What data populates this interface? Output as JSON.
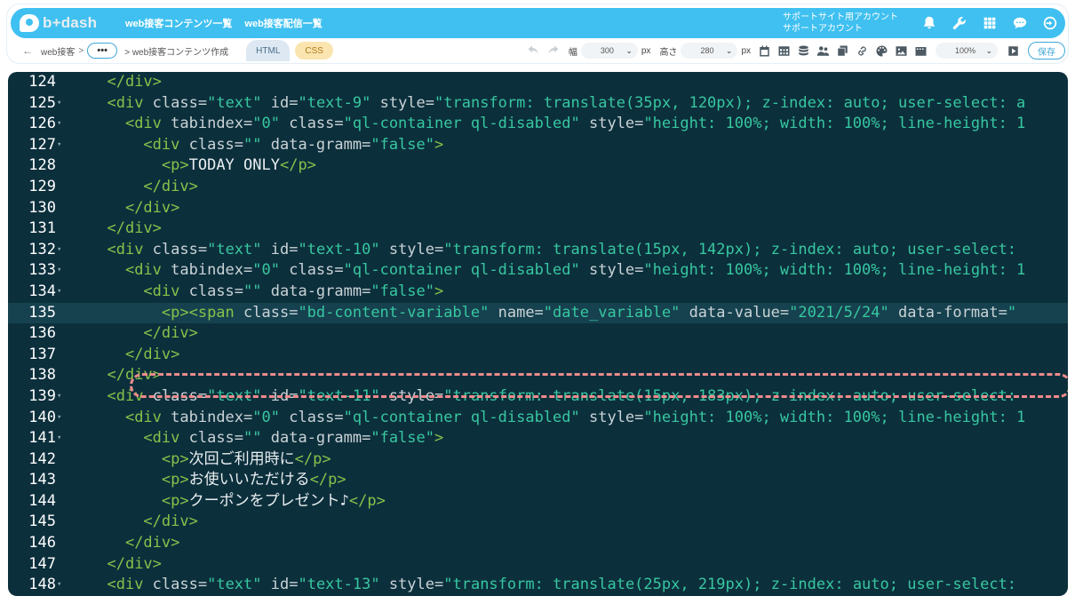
{
  "header": {
    "logo_text": "b+dash",
    "nav": [
      "web接客コンテンツ一覧",
      "web接客配信一覧"
    ],
    "account_line1": "サポートサイト用アカウント",
    "account_line2": "サポートアカウント",
    "icons": [
      "bell-icon",
      "wrench-icon",
      "grid-icon",
      "chat-icon",
      "logout-icon"
    ],
    "brand_color": "#3fc0f0"
  },
  "toolbar": {
    "breadcrumb_root": "web接客",
    "breadcrumb_sep": ">",
    "breadcrumb_more": "•••",
    "breadcrumb_current": "> web接客コンテンツ作成",
    "tab_html": "HTML",
    "tab_css": "CSS",
    "width_label": "幅",
    "width_value": "300",
    "height_label": "高さ",
    "height_value": "280",
    "unit": "px",
    "zoom_value": "100%",
    "save_label": "保存"
  },
  "editor": {
    "active_line": 135,
    "lines": [
      {
        "n": "124",
        "fold": "",
        "segs": [
          [
            "ind",
            "  "
          ],
          [
            "tag",
            "</div>"
          ]
        ]
      },
      {
        "n": "125",
        "fold": "▾",
        "segs": [
          [
            "ind",
            "  "
          ],
          [
            "tag",
            "<div "
          ],
          [
            "attr",
            "class="
          ],
          [
            "val",
            "\"text\""
          ],
          [
            "attr",
            " id="
          ],
          [
            "val",
            "\"text-9\""
          ],
          [
            "attr",
            " style="
          ],
          [
            "val",
            "\"transform: translate(35px, 120px); z-index: auto; user-select: a"
          ]
        ]
      },
      {
        "n": "126",
        "fold": "▾",
        "segs": [
          [
            "ind",
            "    "
          ],
          [
            "tag",
            "<div "
          ],
          [
            "attr",
            "tabindex="
          ],
          [
            "val",
            "\"0\""
          ],
          [
            "attr",
            " class="
          ],
          [
            "val",
            "\"ql-container ql-disabled\""
          ],
          [
            "attr",
            " style="
          ],
          [
            "val",
            "\"height: 100%; width: 100%; line-height: 1"
          ]
        ]
      },
      {
        "n": "127",
        "fold": "▾",
        "segs": [
          [
            "ind",
            "      "
          ],
          [
            "tag",
            "<div "
          ],
          [
            "attr",
            "class="
          ],
          [
            "val",
            "\"\""
          ],
          [
            "attr",
            " data-gramm="
          ],
          [
            "val",
            "\"false\""
          ],
          [
            "tag",
            ">"
          ]
        ]
      },
      {
        "n": "128",
        "fold": "",
        "segs": [
          [
            "ind",
            "        "
          ],
          [
            "tag",
            "<p>"
          ],
          [
            "txt",
            "TODAY ONLY"
          ],
          [
            "tag",
            "</p>"
          ]
        ]
      },
      {
        "n": "129",
        "fold": "",
        "segs": [
          [
            "ind",
            "      "
          ],
          [
            "tag",
            "</div>"
          ]
        ]
      },
      {
        "n": "130",
        "fold": "",
        "segs": [
          [
            "ind",
            "    "
          ],
          [
            "tag",
            "</div>"
          ]
        ]
      },
      {
        "n": "131",
        "fold": "",
        "segs": [
          [
            "ind",
            "  "
          ],
          [
            "tag",
            "</div>"
          ]
        ]
      },
      {
        "n": "132",
        "fold": "▾",
        "segs": [
          [
            "ind",
            "  "
          ],
          [
            "tag",
            "<div "
          ],
          [
            "attr",
            "class="
          ],
          [
            "val",
            "\"text\""
          ],
          [
            "attr",
            " id="
          ],
          [
            "val",
            "\"text-10\""
          ],
          [
            "attr",
            " style="
          ],
          [
            "val",
            "\"transform: translate(15px, 142px); z-index: auto; user-select:"
          ]
        ]
      },
      {
        "n": "133",
        "fold": "▾",
        "segs": [
          [
            "ind",
            "    "
          ],
          [
            "tag",
            "<div "
          ],
          [
            "attr",
            "tabindex="
          ],
          [
            "val",
            "\"0\""
          ],
          [
            "attr",
            " class="
          ],
          [
            "val",
            "\"ql-container ql-disabled\""
          ],
          [
            "attr",
            " style="
          ],
          [
            "val",
            "\"height: 100%; width: 100%; line-height: 1"
          ]
        ]
      },
      {
        "n": "134",
        "fold": "▾",
        "segs": [
          [
            "ind",
            "      "
          ],
          [
            "tag",
            "<div "
          ],
          [
            "attr",
            "class="
          ],
          [
            "val",
            "\"\""
          ],
          [
            "attr",
            " data-gramm="
          ],
          [
            "val",
            "\"false\""
          ],
          [
            "tag",
            ">"
          ]
        ]
      },
      {
        "n": "135",
        "fold": "",
        "segs": [
          [
            "ind",
            "        "
          ],
          [
            "tag",
            "<p><span "
          ],
          [
            "attr",
            "class="
          ],
          [
            "val",
            "\"bd-content-variable\""
          ],
          [
            "attr",
            " name="
          ],
          [
            "val",
            "\"date_variable\""
          ],
          [
            "attr",
            " data-value="
          ],
          [
            "val",
            "\"2021/5/24\""
          ],
          [
            "attr",
            " data-format="
          ],
          [
            "val",
            "\""
          ]
        ]
      },
      {
        "n": "136",
        "fold": "",
        "segs": [
          [
            "ind",
            "      "
          ],
          [
            "tag",
            "</div>"
          ]
        ]
      },
      {
        "n": "137",
        "fold": "",
        "segs": [
          [
            "ind",
            "    "
          ],
          [
            "tag",
            "</div>"
          ]
        ]
      },
      {
        "n": "138",
        "fold": "",
        "segs": [
          [
            "ind",
            "  "
          ],
          [
            "tag",
            "</div>"
          ]
        ]
      },
      {
        "n": "139",
        "fold": "▾",
        "segs": [
          [
            "ind",
            "  "
          ],
          [
            "tag",
            "<div "
          ],
          [
            "attr",
            "class="
          ],
          [
            "val",
            "\"text\""
          ],
          [
            "attr",
            " id="
          ],
          [
            "val",
            "\"text-11\""
          ],
          [
            "attr",
            " style="
          ],
          [
            "val",
            "\"transform: translate(15px, 183px); z-index: auto; user-select:"
          ]
        ]
      },
      {
        "n": "140",
        "fold": "▾",
        "segs": [
          [
            "ind",
            "    "
          ],
          [
            "tag",
            "<div "
          ],
          [
            "attr",
            "tabindex="
          ],
          [
            "val",
            "\"0\""
          ],
          [
            "attr",
            " class="
          ],
          [
            "val",
            "\"ql-container ql-disabled\""
          ],
          [
            "attr",
            " style="
          ],
          [
            "val",
            "\"height: 100%; width: 100%; line-height: 1"
          ]
        ]
      },
      {
        "n": "141",
        "fold": "▾",
        "segs": [
          [
            "ind",
            "      "
          ],
          [
            "tag",
            "<div "
          ],
          [
            "attr",
            "class="
          ],
          [
            "val",
            "\"\""
          ],
          [
            "attr",
            " data-gramm="
          ],
          [
            "val",
            "\"false\""
          ],
          [
            "tag",
            ">"
          ]
        ]
      },
      {
        "n": "142",
        "fold": "",
        "segs": [
          [
            "ind",
            "        "
          ],
          [
            "tag",
            "<p>"
          ],
          [
            "txt",
            "次回ご利用時に"
          ],
          [
            "tag",
            "</p>"
          ]
        ]
      },
      {
        "n": "143",
        "fold": "",
        "segs": [
          [
            "ind",
            "        "
          ],
          [
            "tag",
            "<p>"
          ],
          [
            "txt",
            "お使いいただける"
          ],
          [
            "tag",
            "</p>"
          ]
        ]
      },
      {
        "n": "144",
        "fold": "",
        "segs": [
          [
            "ind",
            "        "
          ],
          [
            "tag",
            "<p>"
          ],
          [
            "txt",
            "クーポンをプレゼント♪"
          ],
          [
            "tag",
            "</p>"
          ]
        ]
      },
      {
        "n": "145",
        "fold": "",
        "segs": [
          [
            "ind",
            "      "
          ],
          [
            "tag",
            "</div>"
          ]
        ]
      },
      {
        "n": "146",
        "fold": "",
        "segs": [
          [
            "ind",
            "    "
          ],
          [
            "tag",
            "</div>"
          ]
        ]
      },
      {
        "n": "147",
        "fold": "",
        "segs": [
          [
            "ind",
            "  "
          ],
          [
            "tag",
            "</div>"
          ]
        ]
      },
      {
        "n": "148",
        "fold": "▾",
        "segs": [
          [
            "ind",
            "  "
          ],
          [
            "tag",
            "<div "
          ],
          [
            "attr",
            "class="
          ],
          [
            "val",
            "\"text\""
          ],
          [
            "attr",
            " id="
          ],
          [
            "val",
            "\"text-13\""
          ],
          [
            "attr",
            " style="
          ],
          [
            "val",
            "\"transform: translate(25px, 219px); z-index: auto; user-select:"
          ]
        ]
      }
    ]
  }
}
